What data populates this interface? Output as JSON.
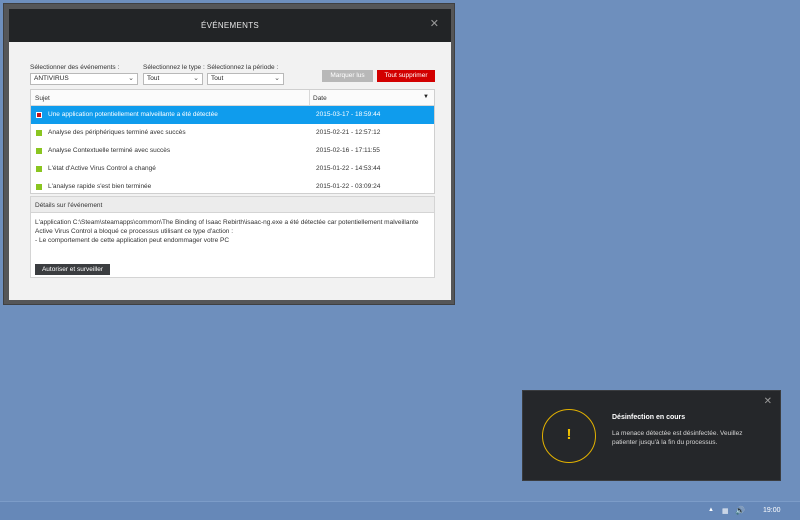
{
  "window": {
    "title": "ÉVÉNEMENTS",
    "close_icon": "close-icon"
  },
  "filters": {
    "events_label": "Sélectionner des événements :",
    "events_value": "ANTIVIRUS",
    "type_label": "Sélectionnez le type :",
    "type_value": "Tout",
    "period_label": "Sélectionnez la période :",
    "period_value": "Tout"
  },
  "buttons": {
    "mark_read": "Marquer lus",
    "delete_all": "Tout supprimer",
    "allow_monitor": "Autoriser et surveiller"
  },
  "table": {
    "col_subject": "Sujet",
    "col_date": "Date",
    "rows": [
      {
        "subject": "Une application potentiellement malveillante a été détectée",
        "date": "2015-03-17 - 18:59:44",
        "status": "threat",
        "selected": true
      },
      {
        "subject": "Analyse des périphériques terminé avec succès",
        "date": "2015-02-21 - 12:57:12",
        "status": "ok"
      },
      {
        "subject": "Analyse Contextuelle terminé avec succès",
        "date": "2015-02-16 - 17:11:55",
        "status": "ok"
      },
      {
        "subject": "L'état d'Active Virus Control a changé",
        "date": "2015-01-22 - 14:53:44",
        "status": "ok"
      },
      {
        "subject": "L'analyse rapide s'est bien terminée",
        "date": "2015-01-22 - 03:09:24",
        "status": "ok"
      }
    ]
  },
  "details": {
    "heading": "Détails sur l'événement",
    "line1": "L'application C:\\Steam\\steamapps\\common\\The Binding of Isaac Rebirth\\isaac-ng.exe a été détectée car potentiellement malveillante",
    "line2": "Active Virus Control a bloqué ce processus utilisant ce type d'action :",
    "line3": "- Le comportement de cette application peut endommager votre PC"
  },
  "notification": {
    "title": "Désinfection en cours",
    "body": "La menace détectée est désinfectée. Veuillez patienter jusqu'à la fin du processus.",
    "symbol": "!"
  },
  "taskbar": {
    "clock": "19:00"
  },
  "colors": {
    "accent_selected": "#0f9ced",
    "danger": "#d20000",
    "ok": "#8ac520",
    "warning": "#f2c200"
  }
}
